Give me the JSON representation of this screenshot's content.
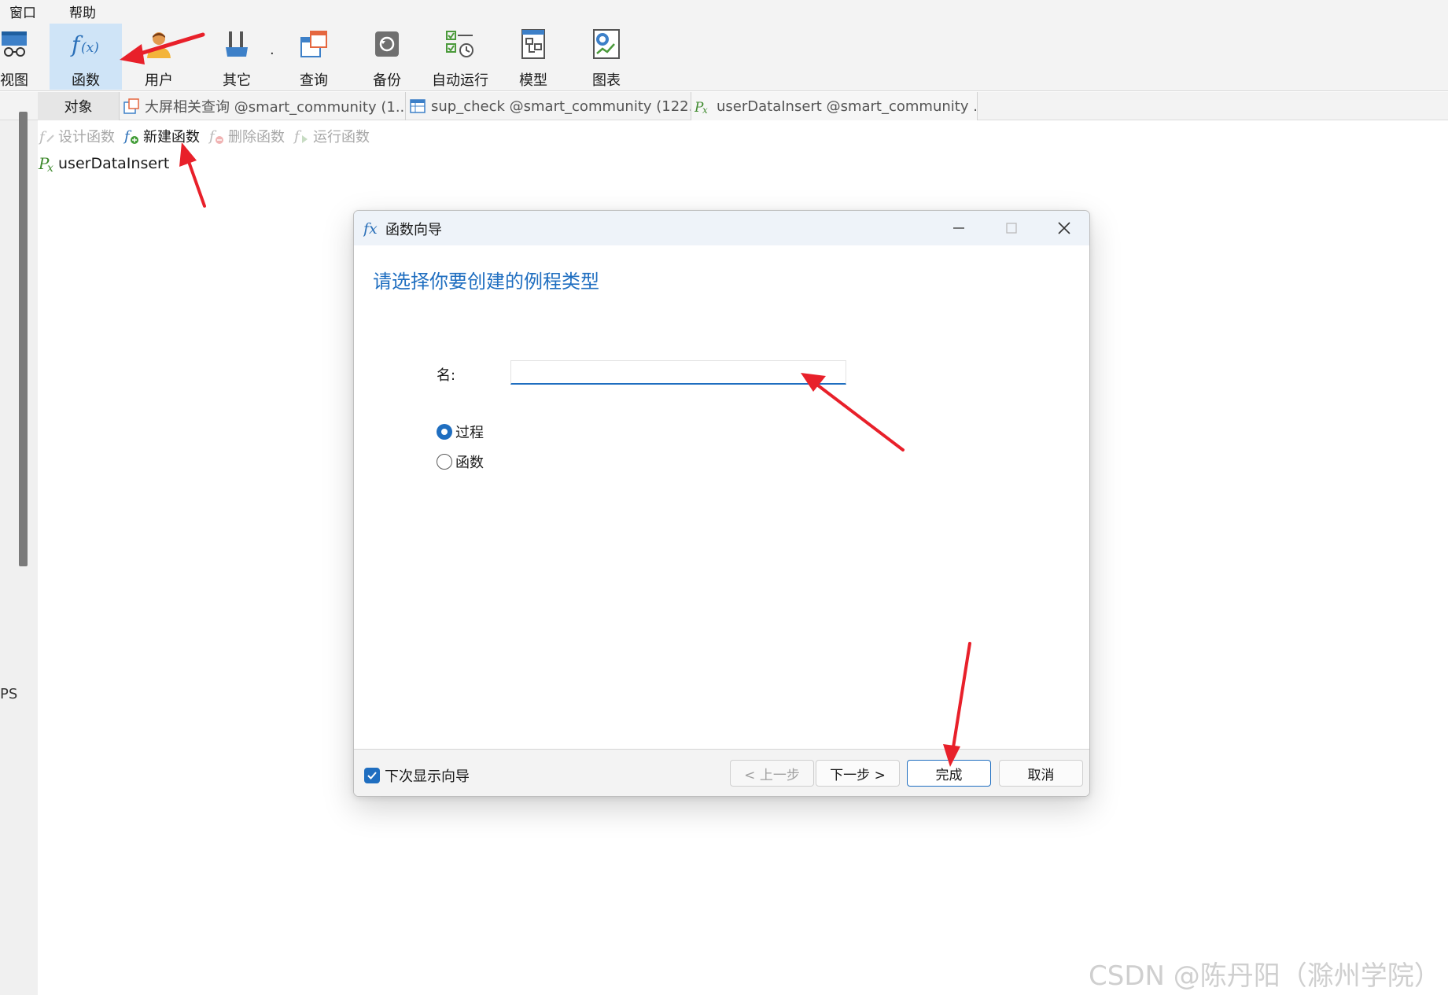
{
  "menu": {
    "window": "窗口",
    "help": "帮助"
  },
  "toolbar": {
    "items": [
      {
        "label": "视图",
        "icon": "view-icon"
      },
      {
        "label": "函数",
        "icon": "function-icon",
        "active": true
      },
      {
        "label": "用户",
        "icon": "user-icon"
      },
      {
        "label": "其它",
        "icon": "tools-icon"
      },
      {
        "label": "查询",
        "icon": "query-icon"
      },
      {
        "label": "备份",
        "icon": "backup-icon"
      },
      {
        "label": "自动运行",
        "icon": "schedule-icon"
      },
      {
        "label": "模型",
        "icon": "model-icon"
      },
      {
        "label": "图表",
        "icon": "chart-icon"
      }
    ],
    "more": "·"
  },
  "tabs": {
    "objects": "对象",
    "items": [
      {
        "label": "大屏相关查询 @smart_community (1...",
        "icon": "query-tab-icon"
      },
      {
        "label": "sup_check @smart_community (122...",
        "icon": "table-tab-icon"
      },
      {
        "label": "userDataInsert @smart_community ...",
        "icon": "procedure-tab-icon"
      }
    ]
  },
  "subtoolbar": {
    "design": "设计函数",
    "new": "新建函数",
    "delete": "删除函数",
    "run": "运行函数"
  },
  "objects_list": [
    {
      "label": "userDataInsert",
      "icon": "procedure-icon"
    }
  ],
  "left_edge_text": "PS",
  "dialog": {
    "title": "函数向导",
    "heading": "请选择你要创建的例程类型",
    "name_label": "名:",
    "name_value": "",
    "options": [
      {
        "label": "过程",
        "checked": true
      },
      {
        "label": "函数",
        "checked": false
      }
    ],
    "show_next_time": "下次显示向导",
    "show_next_time_checked": true,
    "buttons": {
      "prev": "< 上一步",
      "next": "下一步 >",
      "finish": "完成",
      "cancel": "取消"
    }
  },
  "watermark": "CSDN @陈丹阳（滁州学院）",
  "colors": {
    "accent": "#1f6ec0",
    "annotation_arrow": "#e8202a",
    "active_tab": "#cfe4f7"
  }
}
